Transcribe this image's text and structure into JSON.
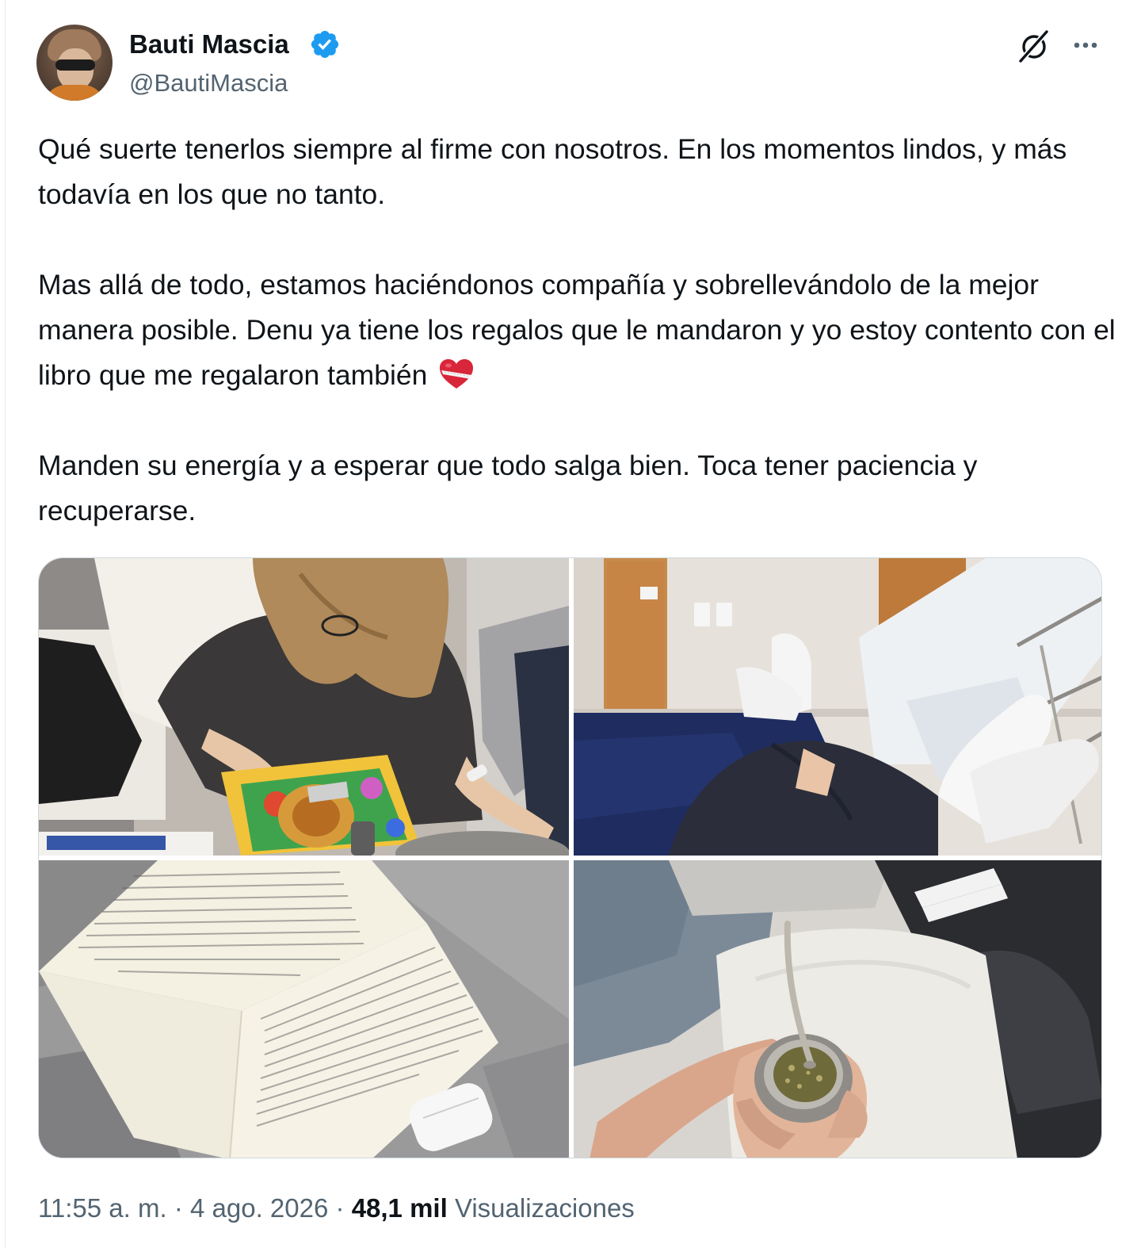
{
  "author": {
    "display_name": "Bauti Mascia",
    "handle": "@BautiMascia",
    "verified": true,
    "verified_color": "#1d9bf0"
  },
  "icons": {
    "grok": "grok-icon",
    "more": "more-icon",
    "heart_emoji": "mending-heart-icon"
  },
  "tweet": {
    "paragraphs": [
      "Qué suerte tenerlos siempre al firme con nosotros. En los momentos lindos, y más todavía en los que no tanto.",
      "Mas allá de todo, estamos haciéndonos compañía y sobrellevándolo de la mejor manera posible. Denu ya tiene los regalos que le mandaron y yo estoy contento con el libro que me regalaron también",
      "Manden su energía y a esperar que todo salga bien. Toca tener paciencia y recuperarse."
    ]
  },
  "media": [
    {
      "name": "photo-girl-painting"
    },
    {
      "name": "photo-feet-in-socks"
    },
    {
      "name": "photo-open-book"
    },
    {
      "name": "photo-mate-gourd"
    }
  ],
  "footer": {
    "time": "11:55 a. m.",
    "separator": "·",
    "date": "4 ago. 2026",
    "views_count": "48,1 mil",
    "views_label": "Visualizaciones"
  },
  "colors": {
    "text_primary": "#0f1419",
    "text_secondary": "#536471",
    "border": "#cfd9de",
    "accent": "#1d9bf0"
  }
}
